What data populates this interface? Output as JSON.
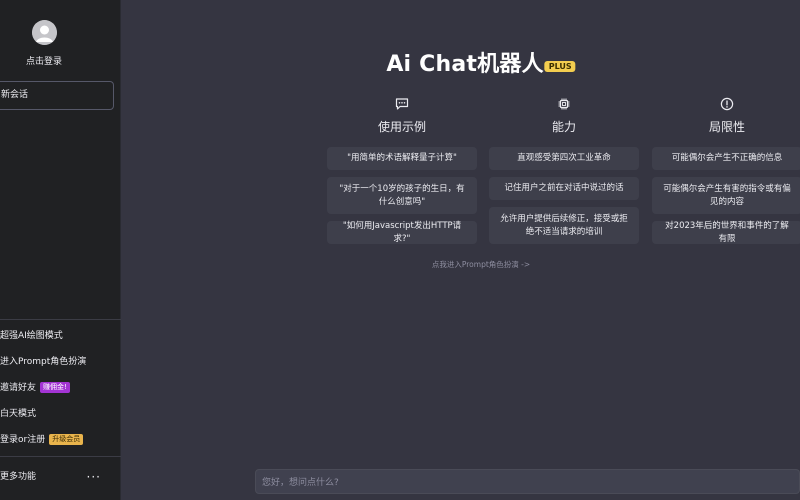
{
  "sidebar": {
    "login_label": "点击登录",
    "new_chat_label": "新会话",
    "menu": [
      {
        "label": "超强AI绘图模式"
      },
      {
        "label": "进入Prompt角色扮演"
      },
      {
        "label": "邀请好友",
        "badge": "赚佣金!"
      },
      {
        "label": "白天模式"
      },
      {
        "label": "登录or注册",
        "badge": "升级会员"
      }
    ],
    "more_label": "更多功能",
    "more_icon": "···"
  },
  "main": {
    "title": "Ai Chat机器人",
    "title_badge": "PLUS",
    "columns": [
      {
        "icon": "chat-bubble-icon",
        "heading": "使用示例",
        "cards": [
          "\"用简单的术语解释量子计算\"",
          "\"对于一个10岁的孩子的生日，有什么创意吗\"",
          "\"如何用Javascript发出HTTP请求?\""
        ]
      },
      {
        "icon": "chip-icon",
        "heading": "能力",
        "cards": [
          "直观感受第四次工业革命",
          "记住用户之前在对话中说过的话",
          "允许用户提供后续修正，接受或拒绝不适当请求的培训"
        ]
      },
      {
        "icon": "alert-circle-icon",
        "heading": "局限性",
        "cards": [
          "可能偶尔会产生不正确的信息",
          "可能偶尔会产生有害的指令或有偏见的内容",
          "对2023年后的世界和事件的了解有限"
        ]
      }
    ],
    "prompt_link": "点我进入Prompt角色扮演 ->",
    "input_placeholder": "您好，想问点什么?"
  }
}
